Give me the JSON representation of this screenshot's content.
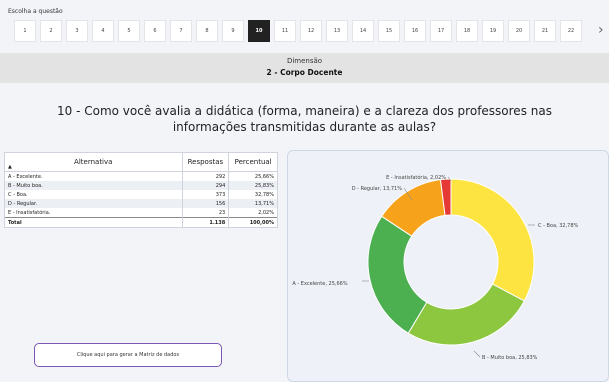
{
  "question_selector": {
    "label": "Escolha a questão",
    "numbers": [
      "1",
      "2",
      "3",
      "4",
      "5",
      "6",
      "7",
      "8",
      "9",
      "10",
      "11",
      "12",
      "13",
      "14",
      "15",
      "16",
      "17",
      "18",
      "19",
      "20",
      "21",
      "22"
    ],
    "active": "10",
    "next_icon": "chevron-right-icon"
  },
  "dimension": {
    "label": "Dimensão",
    "name": "2 - Corpo Docente"
  },
  "question": {
    "text": "10 - Como você avalia a didática (forma, maneira) e a clareza dos professores nas informações transmitidas durante as aulas?"
  },
  "table": {
    "headers": {
      "alternativa": "Alternativa",
      "respostas": "Respostas",
      "percentual": "Percentual"
    },
    "rows": [
      {
        "alt": "A - Excelente.",
        "resp": "292",
        "pct": "25,66%"
      },
      {
        "alt": "B - Muito boa.",
        "resp": "294",
        "pct": "25,83%"
      },
      {
        "alt": "C - Boa.",
        "resp": "373",
        "pct": "32,78%"
      },
      {
        "alt": "D - Regular.",
        "resp": "156",
        "pct": "13,71%"
      },
      {
        "alt": "E - Insatisfatória.",
        "resp": "23",
        "pct": "2,02%"
      }
    ],
    "total": {
      "alt": "Total",
      "resp": "1.138",
      "pct": "100,00%"
    }
  },
  "matrix_button": {
    "label": "Clique aqui para gerar a Matriz de dados"
  },
  "chart_data": {
    "type": "pie",
    "donut": true,
    "slices": [
      {
        "label": "C - Boa",
        "value": 32.78,
        "display": "C - Boa, 32,78%",
        "color": "#fde440"
      },
      {
        "label": "B - Muito boa",
        "value": 25.83,
        "display": "B - Muito boa, 25,83%",
        "color": "#8dc63f"
      },
      {
        "label": "A - Excelente",
        "value": 25.66,
        "display": "A - Excelente, 25,66%",
        "color": "#4caf50"
      },
      {
        "label": "D - Regular",
        "value": 13.71,
        "display": "D - Regular, 13,71%",
        "color": "#f7a21b"
      },
      {
        "label": "E - Insatisfatória",
        "value": 2.02,
        "display": "E - Insatisfatória, 2,02%",
        "color": "#e53935"
      }
    ]
  }
}
